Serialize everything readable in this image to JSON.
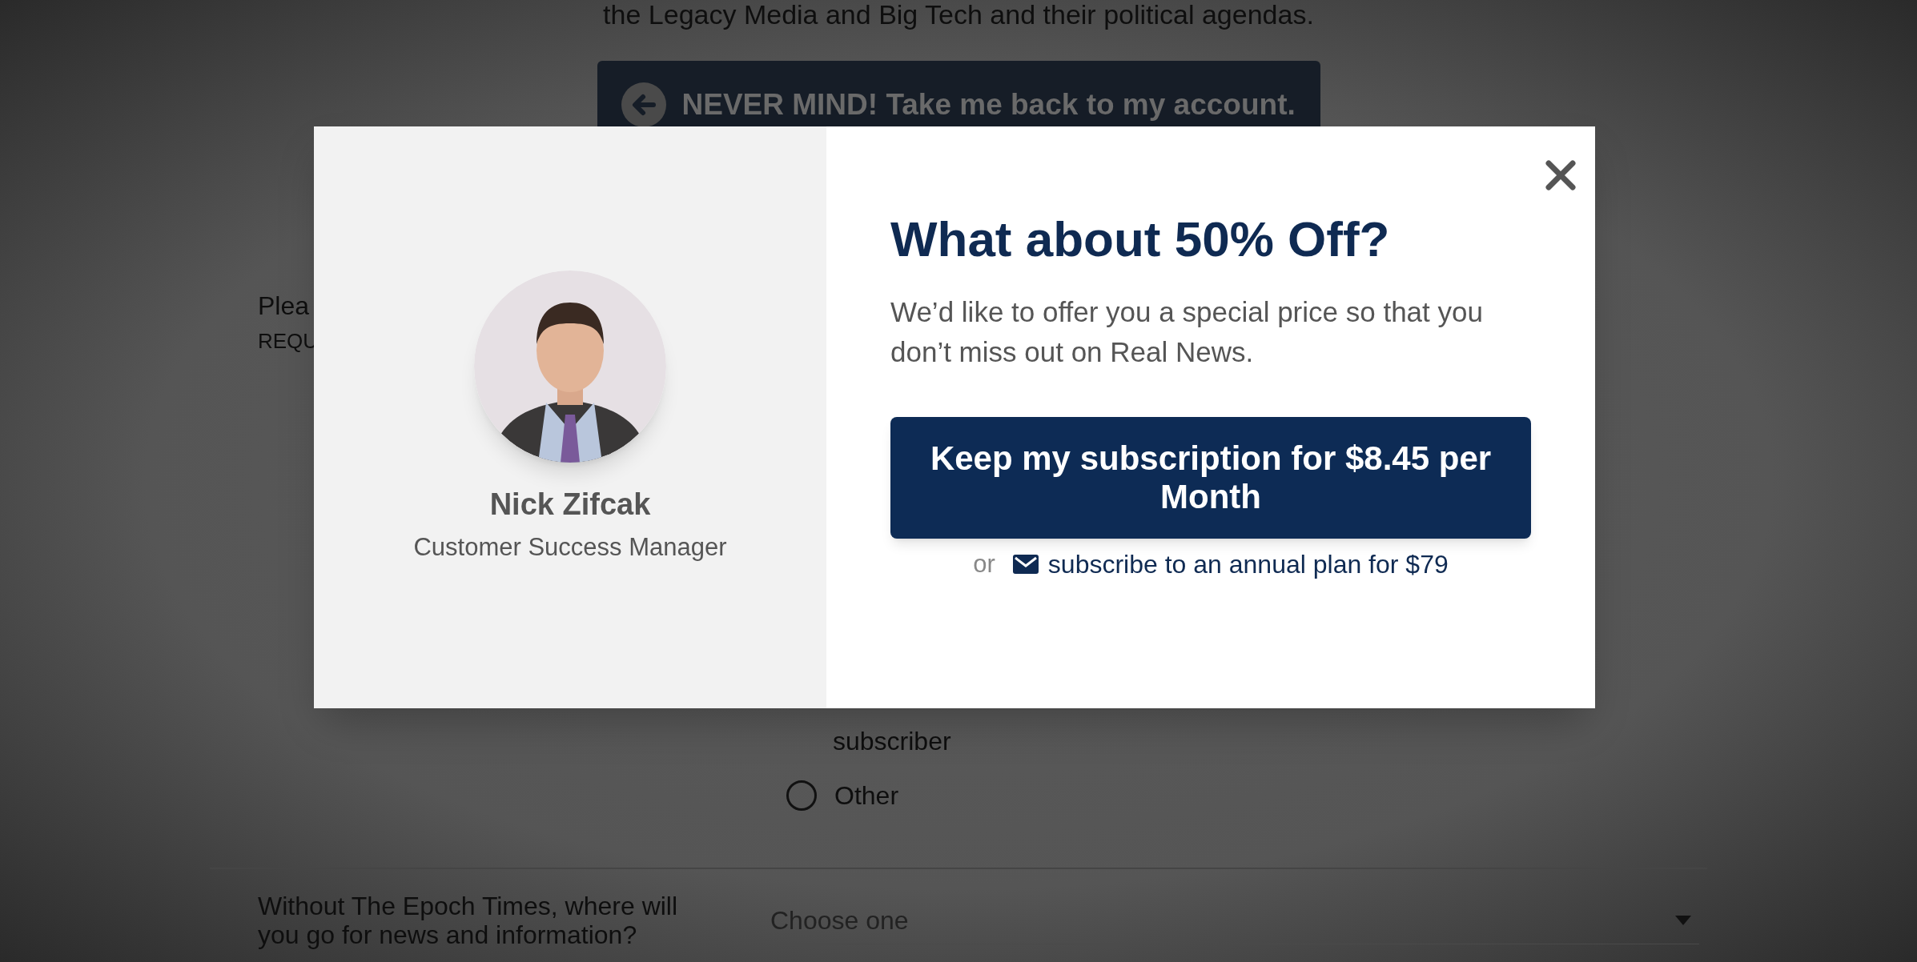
{
  "background": {
    "intro_tail": "the Legacy Media and Big Tech and their political agendas.",
    "back_button": "NEVER MIND! Take me back to my account.",
    "question_label": "Plea",
    "required_label": "REQU",
    "option_continuation": "subscriber",
    "options": [
      {
        "label": "Other",
        "selected": false
      }
    ],
    "second_question": {
      "label": "Without The Epoch Times, where will you go for news and information?",
      "placeholder": "Choose one"
    }
  },
  "modal": {
    "agent": {
      "name": "Nick Zifcak",
      "role": "Customer Success Manager"
    },
    "offer": {
      "heading": "What about 50% Off?",
      "text": "We’d like to offer you a special price so that you don’t miss out on Real News.",
      "keep_button": "Keep my subscription for $8.45 per Month",
      "or": "or",
      "annual_link": "subscribe to an annual plan for $79"
    }
  }
}
